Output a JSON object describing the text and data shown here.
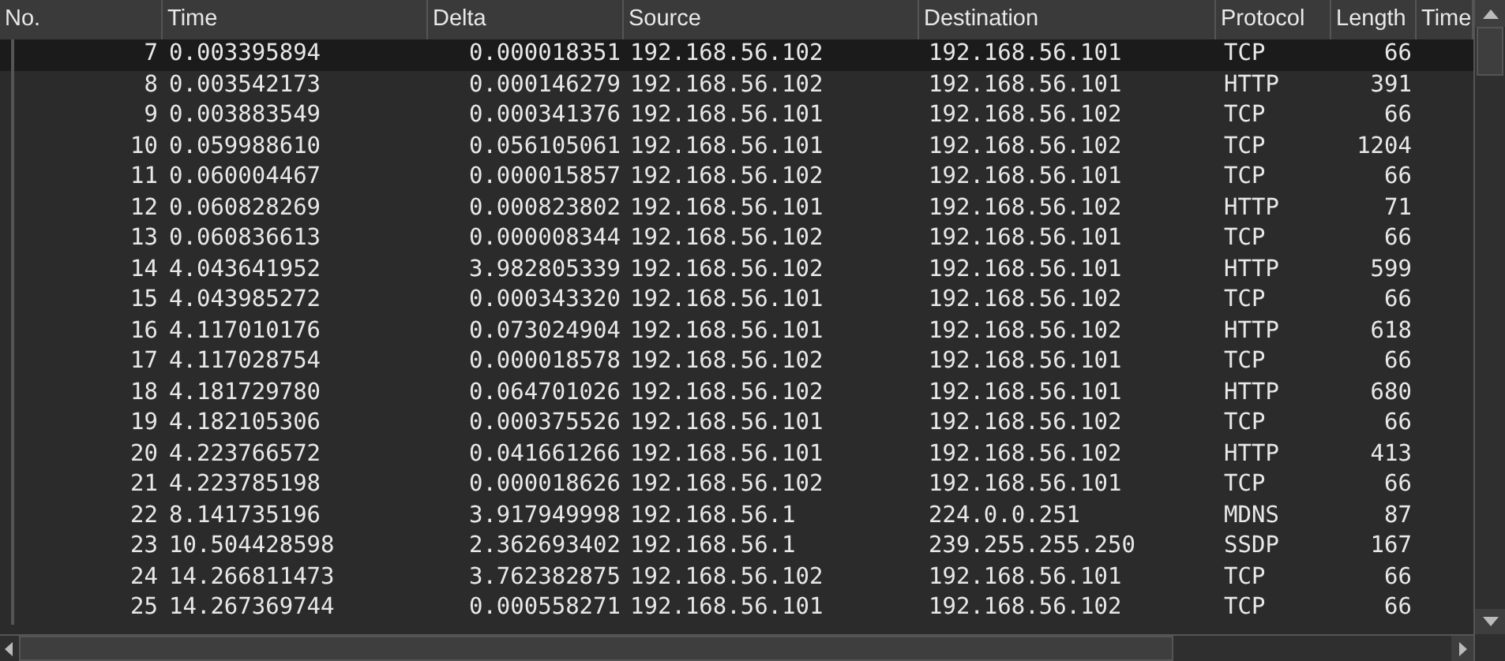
{
  "columns": [
    "No.",
    "Time",
    "Delta",
    "Source",
    "Destination",
    "Protocol",
    "Length",
    "Time"
  ],
  "rows": [
    {
      "no": "7",
      "time": "0.003395894",
      "delta": "0.000018351",
      "source": "192.168.56.102",
      "destination": "192.168.56.101",
      "protocol": "TCP",
      "length": "66",
      "selected": true
    },
    {
      "no": "8",
      "time": "0.003542173",
      "delta": "0.000146279",
      "source": "192.168.56.102",
      "destination": "192.168.56.101",
      "protocol": "HTTP",
      "length": "391",
      "selected": false
    },
    {
      "no": "9",
      "time": "0.003883549",
      "delta": "0.000341376",
      "source": "192.168.56.101",
      "destination": "192.168.56.102",
      "protocol": "TCP",
      "length": "66",
      "selected": false
    },
    {
      "no": "10",
      "time": "0.059988610",
      "delta": "0.056105061",
      "source": "192.168.56.101",
      "destination": "192.168.56.102",
      "protocol": "TCP",
      "length": "1204",
      "selected": false
    },
    {
      "no": "11",
      "time": "0.060004467",
      "delta": "0.000015857",
      "source": "192.168.56.102",
      "destination": "192.168.56.101",
      "protocol": "TCP",
      "length": "66",
      "selected": false
    },
    {
      "no": "12",
      "time": "0.060828269",
      "delta": "0.000823802",
      "source": "192.168.56.101",
      "destination": "192.168.56.102",
      "protocol": "HTTP",
      "length": "71",
      "selected": false
    },
    {
      "no": "13",
      "time": "0.060836613",
      "delta": "0.000008344",
      "source": "192.168.56.102",
      "destination": "192.168.56.101",
      "protocol": "TCP",
      "length": "66",
      "selected": false
    },
    {
      "no": "14",
      "time": "4.043641952",
      "delta": "3.982805339",
      "source": "192.168.56.102",
      "destination": "192.168.56.101",
      "protocol": "HTTP",
      "length": "599",
      "selected": false
    },
    {
      "no": "15",
      "time": "4.043985272",
      "delta": "0.000343320",
      "source": "192.168.56.101",
      "destination": "192.168.56.102",
      "protocol": "TCP",
      "length": "66",
      "selected": false
    },
    {
      "no": "16",
      "time": "4.117010176",
      "delta": "0.073024904",
      "source": "192.168.56.101",
      "destination": "192.168.56.102",
      "protocol": "HTTP",
      "length": "618",
      "selected": false
    },
    {
      "no": "17",
      "time": "4.117028754",
      "delta": "0.000018578",
      "source": "192.168.56.102",
      "destination": "192.168.56.101",
      "protocol": "TCP",
      "length": "66",
      "selected": false
    },
    {
      "no": "18",
      "time": "4.181729780",
      "delta": "0.064701026",
      "source": "192.168.56.102",
      "destination": "192.168.56.101",
      "protocol": "HTTP",
      "length": "680",
      "selected": false
    },
    {
      "no": "19",
      "time": "4.182105306",
      "delta": "0.000375526",
      "source": "192.168.56.101",
      "destination": "192.168.56.102",
      "protocol": "TCP",
      "length": "66",
      "selected": false
    },
    {
      "no": "20",
      "time": "4.223766572",
      "delta": "0.041661266",
      "source": "192.168.56.101",
      "destination": "192.168.56.102",
      "protocol": "HTTP",
      "length": "413",
      "selected": false
    },
    {
      "no": "21",
      "time": "4.223785198",
      "delta": "0.000018626",
      "source": "192.168.56.102",
      "destination": "192.168.56.101",
      "protocol": "TCP",
      "length": "66",
      "selected": false
    },
    {
      "no": "22",
      "time": "8.141735196",
      "delta": "3.917949998",
      "source": "192.168.56.1",
      "destination": "224.0.0.251",
      "protocol": "MDNS",
      "length": "87",
      "selected": false
    },
    {
      "no": "23",
      "time": "10.504428598",
      "delta": "2.362693402",
      "source": "192.168.56.1",
      "destination": "239.255.255.250",
      "protocol": "SSDP",
      "length": "167",
      "selected": false
    },
    {
      "no": "24",
      "time": "14.266811473",
      "delta": "3.762382875",
      "source": "192.168.56.102",
      "destination": "192.168.56.101",
      "protocol": "TCP",
      "length": "66",
      "selected": false
    },
    {
      "no": "25",
      "time": "14.267369744",
      "delta": "0.000558271",
      "source": "192.168.56.101",
      "destination": "192.168.56.102",
      "protocol": "TCP",
      "length": "66",
      "selected": false
    }
  ]
}
